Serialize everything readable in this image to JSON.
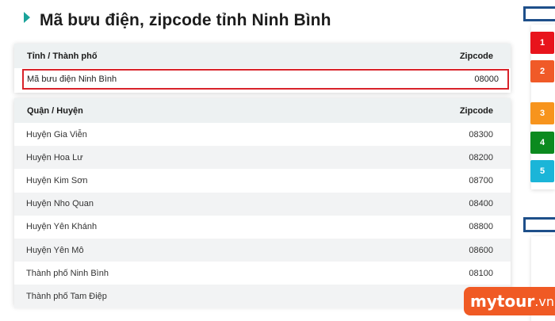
{
  "page": {
    "title": "Mã bưu điện, zipcode tỉnh Ninh Bình"
  },
  "province_table": {
    "headers": {
      "name": "Tỉnh / Thành phố",
      "zipcode": "Zipcode"
    },
    "row": {
      "name": "Mã bưu điện Ninh Bình",
      "zipcode": "08000"
    }
  },
  "district_table": {
    "headers": {
      "name": "Quận / Huyện",
      "zipcode": "Zipcode"
    },
    "rows": [
      {
        "name": "Huyện Gia Viễn",
        "zipcode": "08300"
      },
      {
        "name": "Huyện Hoa Lư",
        "zipcode": "08200"
      },
      {
        "name": "Huyện Kim Sơn",
        "zipcode": "08700"
      },
      {
        "name": "Huyện Nho Quan",
        "zipcode": "08400"
      },
      {
        "name": "Huyện Yên Khánh",
        "zipcode": "08800"
      },
      {
        "name": "Huyện Yên Mô",
        "zipcode": "08600"
      },
      {
        "name": "Thành phố Ninh Bình",
        "zipcode": "08100"
      },
      {
        "name": "Thành phố Tam Điệp",
        "zipcode": ""
      }
    ]
  },
  "sidebar": {
    "badges": [
      {
        "label": "1",
        "color": "#e8141c"
      },
      {
        "label": "2",
        "color": "#f05a28"
      },
      {
        "label": "3",
        "color": "#f7941d"
      },
      {
        "label": "4",
        "color": "#0b8a1f"
      },
      {
        "label": "5",
        "color": "#1bb5d8"
      }
    ]
  },
  "watermark": {
    "text": "mytour",
    "suffix": ".vn"
  }
}
